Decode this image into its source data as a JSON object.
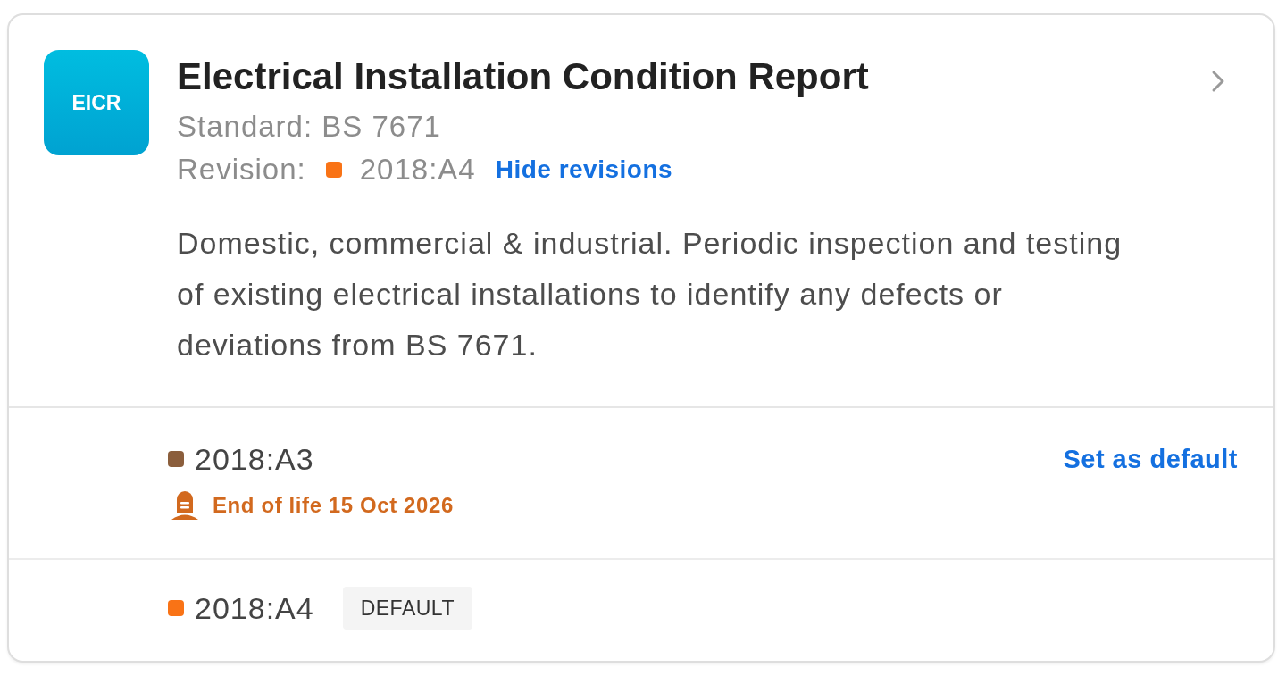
{
  "report": {
    "badge": "EICR",
    "title": "Electrical Installation Condition Report",
    "standard": "Standard: BS 7671",
    "revision_label": "Revision:",
    "revision": {
      "name": "2018:A4",
      "color": "#f97316"
    },
    "toggle_link": "Hide revisions",
    "description": "Domestic, commercial & industrial. Periodic inspection and testing of existing electrical installations to identify any defects or deviations from BS 7671."
  },
  "revisions": [
    {
      "name": "2018:A3",
      "color": "#8b5e3c",
      "action": "Set as default",
      "end_of_life": "End of life 15 Oct 2026"
    },
    {
      "name": "2018:A4",
      "color": "#f97316",
      "badge": "DEFAULT"
    }
  ]
}
